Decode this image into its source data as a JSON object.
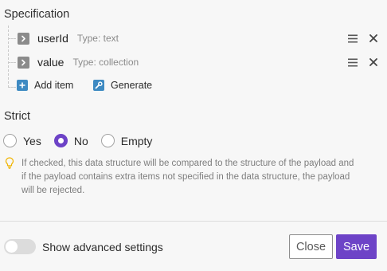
{
  "specification": {
    "title": "Specification",
    "items": [
      {
        "name": "userId",
        "type": "Type: text"
      },
      {
        "name": "value",
        "type": "Type: collection"
      }
    ],
    "add_item_label": "Add item",
    "generate_label": "Generate"
  },
  "strict": {
    "title": "Strict",
    "options": [
      {
        "label": "Yes",
        "checked": false
      },
      {
        "label": "No",
        "checked": true
      },
      {
        "label": "Empty",
        "checked": false
      }
    ],
    "hint": "If checked, this data structure will be compared to the structure of the payload and if the payload contains extra items not specified in the data structure, the payload will be rejected."
  },
  "footer": {
    "advanced_label": "Show advanced settings",
    "advanced_enabled": false,
    "close_label": "Close",
    "save_label": "Save"
  },
  "colors": {
    "accent": "#6d43c7",
    "link_icon": "#3e8ac2",
    "hint_icon": "#f0b400"
  }
}
